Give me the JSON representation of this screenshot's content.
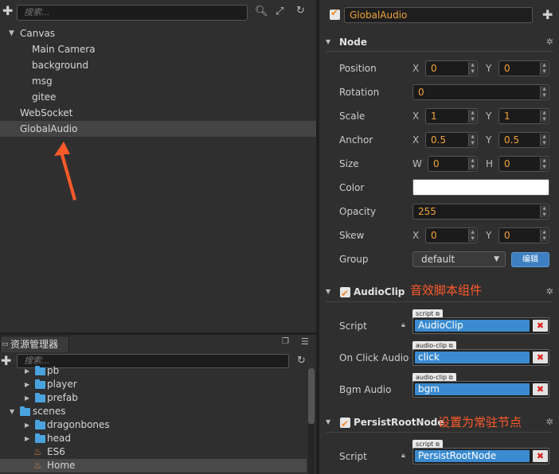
{
  "hierarchy": {
    "search_placeholder": "搜索...",
    "items": [
      {
        "label": "Canvas"
      },
      {
        "label": "Main Camera"
      },
      {
        "label": "background"
      },
      {
        "label": "msg"
      },
      {
        "label": "gitee"
      },
      {
        "label": "WebSocket"
      },
      {
        "label": "GlobalAudio"
      }
    ]
  },
  "assets": {
    "tab_label": "资源管理器",
    "search_placeholder": "搜索...",
    "items": [
      {
        "label": "pb"
      },
      {
        "label": "player"
      },
      {
        "label": "prefab"
      },
      {
        "label": "scenes"
      },
      {
        "label": "dragonbones"
      },
      {
        "label": "head"
      },
      {
        "label": "ES6"
      },
      {
        "label": "Home"
      }
    ]
  },
  "inspector": {
    "node_name": "GlobalAudio",
    "node_section": {
      "title": "Node",
      "position": {
        "label": "Position",
        "x_label": "X",
        "x": "0",
        "y_label": "Y",
        "y": "0"
      },
      "rotation": {
        "label": "Rotation",
        "value": "0"
      },
      "scale": {
        "label": "Scale",
        "x_label": "X",
        "x": "1",
        "y_label": "Y",
        "y": "1"
      },
      "anchor": {
        "label": "Anchor",
        "x_label": "X",
        "x": "0.5",
        "y_label": "Y",
        "y": "0.5"
      },
      "size": {
        "label": "Size",
        "w_label": "W",
        "w": "0",
        "h_label": "H",
        "h": "0"
      },
      "color": {
        "label": "Color",
        "value": "#ffffff"
      },
      "opacity": {
        "label": "Opacity",
        "value": "255"
      },
      "skew": {
        "label": "Skew",
        "x_label": "X",
        "x": "0",
        "y_label": "Y",
        "y": "0"
      },
      "group": {
        "label": "Group",
        "value": "default",
        "edit_label": "编辑"
      }
    },
    "audioclip_section": {
      "title": "AudioClip",
      "annotation": "音效脚本组件",
      "script": {
        "label": "Script",
        "tag": "script",
        "value": "AudioClip"
      },
      "on_click_audio": {
        "label": "On Click Audio",
        "tag": "audio-clip",
        "value": "click"
      },
      "bgm_audio": {
        "label": "Bgm Audio",
        "tag": "audio-clip",
        "value": "bgm"
      }
    },
    "persist_section": {
      "title": "PersistRootNode",
      "annotation": "设置为常驻节点",
      "script": {
        "label": "Script",
        "tag": "script",
        "value": "PersistRootNode"
      }
    }
  },
  "colors": {
    "accent": "#f0a33a",
    "selection": "#3a8bd0",
    "annotation": "#ff5a2a",
    "folder": "#4aa3df"
  }
}
